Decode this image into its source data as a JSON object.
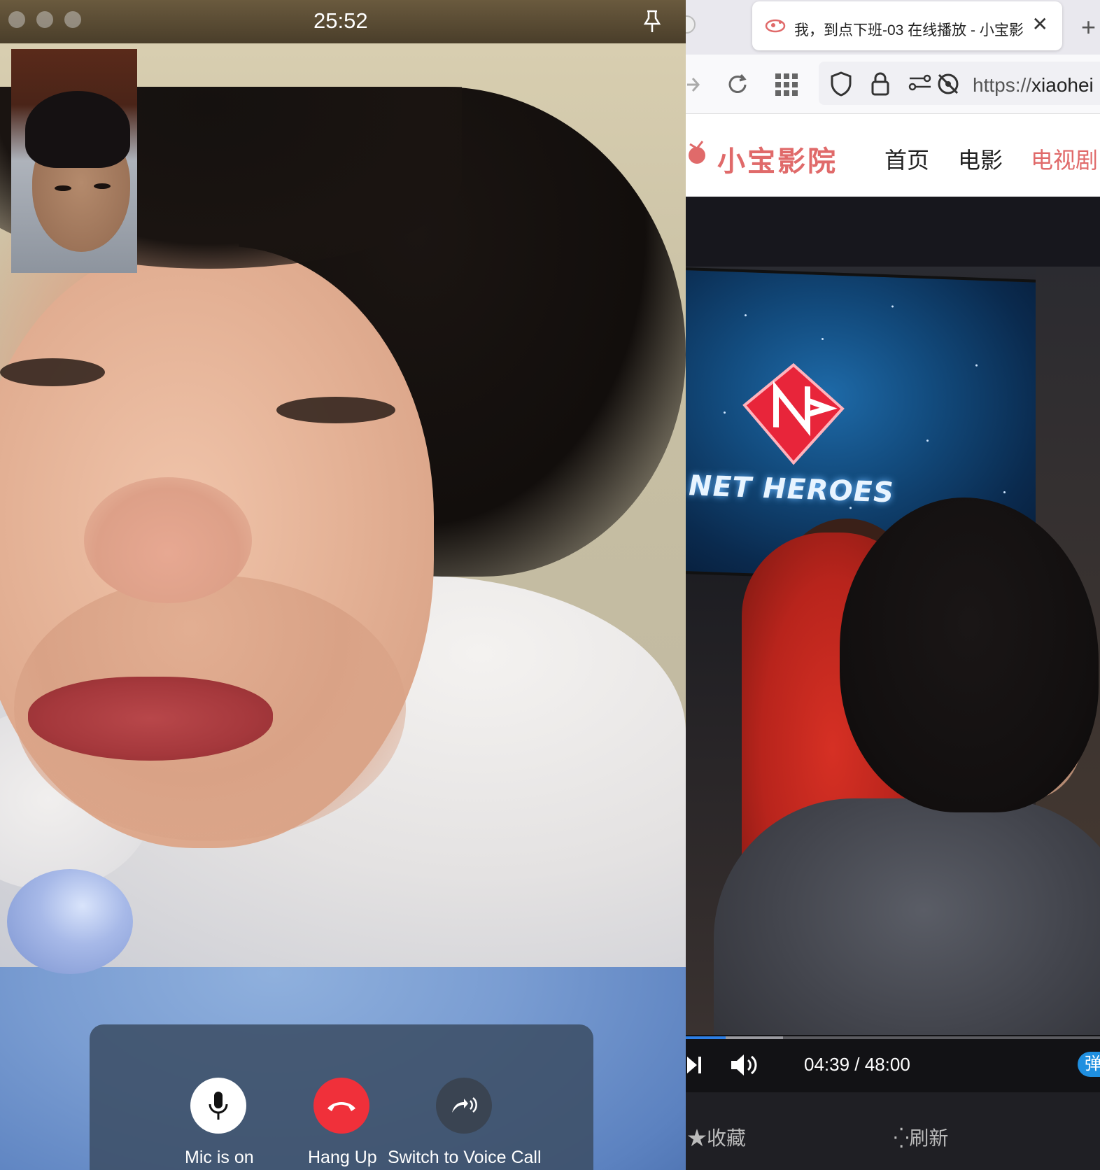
{
  "facetime": {
    "call_duration": "25:52",
    "controls": {
      "mic_label": "Mic is on",
      "hangup_label": "Hang Up",
      "voice_label": "Switch to Voice Call"
    },
    "colors": {
      "hangup": "#f0303a",
      "bar": "#3c4e66"
    }
  },
  "browser": {
    "tab": {
      "title": "我，到点下班-03 在线播放 - 小宝影",
      "close_glyph": "✕"
    },
    "new_tab_glyph": "+",
    "url": {
      "scheme": "https://",
      "host": "xiaohei"
    }
  },
  "site": {
    "logo": "小宝影院",
    "nav": [
      {
        "label": "首页",
        "active": false
      },
      {
        "label": "电影",
        "active": false
      },
      {
        "label": "电视剧",
        "active": true
      }
    ],
    "accent": "#e06a6a"
  },
  "player": {
    "scene_text": "NET HEROES",
    "current_time": "04:39",
    "duration": "48:00",
    "time_text": "04:39 / 48:00",
    "progress_fraction": 0.097,
    "buffer_fraction": 0.235,
    "danmu_label": "弹"
  },
  "bottom_bar": {
    "favorite": "收藏",
    "refresh": "刷新"
  }
}
